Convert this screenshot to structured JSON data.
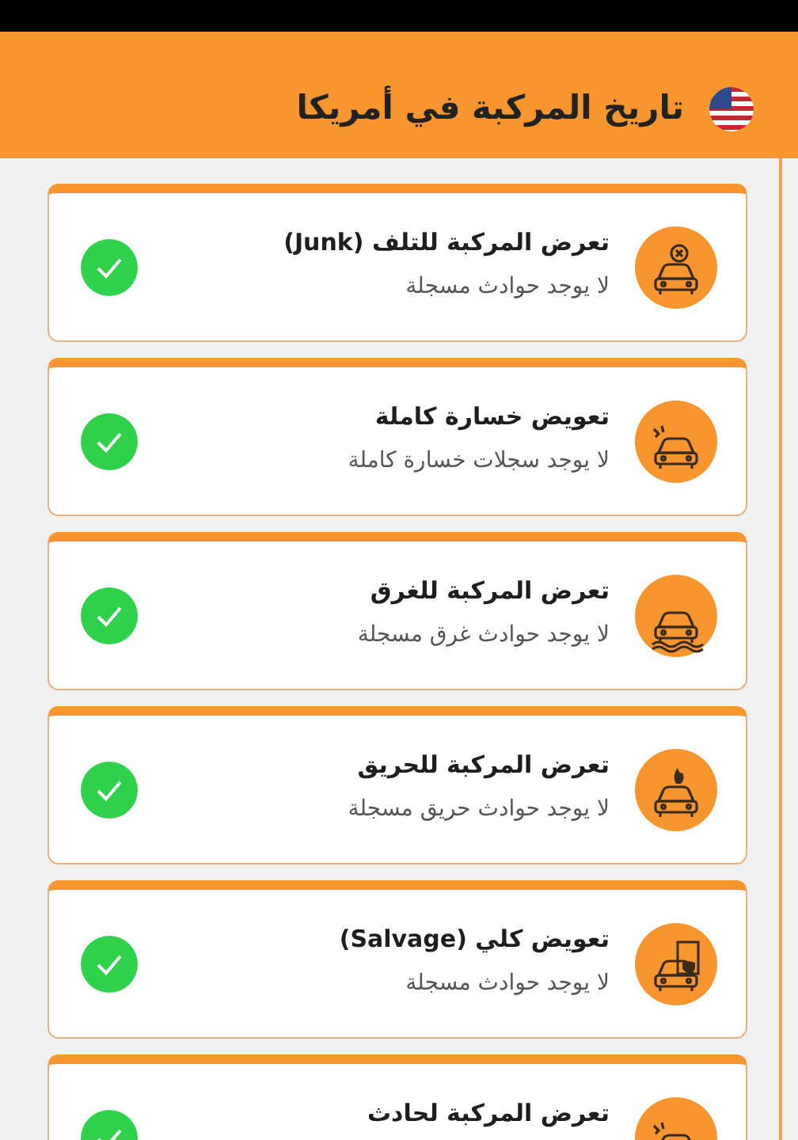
{
  "header": {
    "title": "تاريخ المركبة في أمريكا"
  },
  "records": [
    {
      "kind": "junk",
      "title": "تعرض المركبة للتلف (Junk)",
      "detail": "لا يوجد حوادث مسجلة",
      "passed": true
    },
    {
      "kind": "total-loss",
      "title": "تعويض خسارة كاملة",
      "detail": "لا يوجد سجلات خسارة كاملة",
      "passed": true
    },
    {
      "kind": "flood",
      "title": "تعرض المركبة للغرق",
      "detail": "لا يوجد حوادث غرق مسجلة",
      "passed": true
    },
    {
      "kind": "fire",
      "title": "تعرض المركبة للحريق",
      "detail": "لا يوجد حوادث حريق مسجلة",
      "passed": true
    },
    {
      "kind": "salvage",
      "title": "تعويض كلي (Salvage)",
      "detail": "لا يوجد حوادث مسجلة",
      "passed": true
    },
    {
      "kind": "accident",
      "title": "تعرض المركبة لحادث",
      "passed": true
    }
  ]
}
